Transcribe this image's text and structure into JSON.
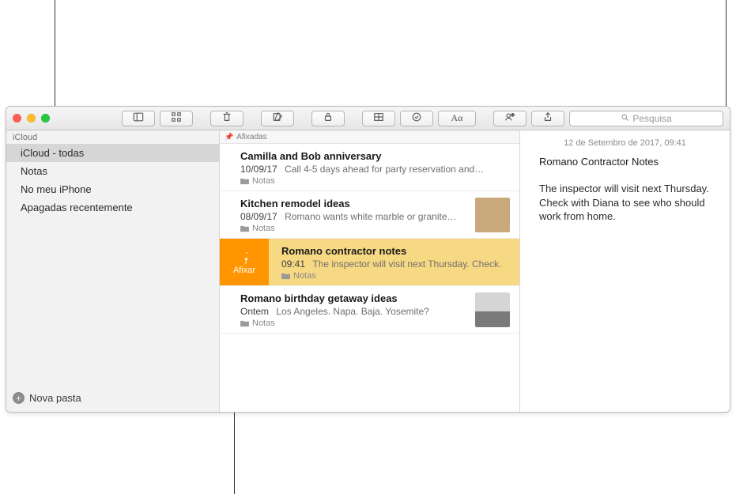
{
  "toolbar": {
    "search_placeholder": "Pesquisa"
  },
  "sidebar": {
    "section": "iCloud",
    "items": [
      {
        "label": "iCloud - todas",
        "selected": true
      },
      {
        "label": "Notas",
        "selected": false
      },
      {
        "label": "No meu iPhone",
        "selected": false
      },
      {
        "label": "Apagadas recentemente",
        "selected": false
      }
    ],
    "new_folder_label": "Nova pasta"
  },
  "list": {
    "header_label": "Afixadas",
    "pin_action_label": "Afixar",
    "folder_label": "Notas",
    "notes": [
      {
        "title": "Camilla and Bob anniversary",
        "date": "10/09/17",
        "preview": "Call 4-5 days ahead for party reservation and…",
        "has_thumb": false,
        "selected": false
      },
      {
        "title": "Kitchen remodel ideas",
        "date": "08/09/17",
        "preview": "Romano wants white marble or granite…",
        "has_thumb": true,
        "thumb_variant": "wood",
        "selected": false
      },
      {
        "title": "Romano contractor notes",
        "date": "09:41",
        "preview": "The inspector will visit next Thursday. Check.",
        "has_thumb": false,
        "selected": true
      },
      {
        "title": "Romano birthday getaway ideas",
        "date": "Ontem",
        "preview": "Los Angeles. Napa. Baja. Yosemite?",
        "has_thumb": true,
        "thumb_variant": "alt",
        "selected": false
      }
    ]
  },
  "editor": {
    "date": "12 de Setembro de 2017, 09:41",
    "title": "Romano Contractor Notes",
    "body": "The inspector will visit next Thursday. Check with Diana to see who should work from home."
  }
}
